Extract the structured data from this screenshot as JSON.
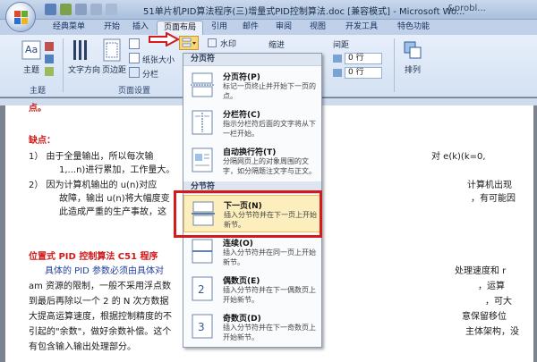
{
  "titlebar": {
    "doc_title": "51单片机PID算法程序(三)增量式PID控制算法.doc [兼容模式] - Microsoft Wo...",
    "right_text": "&probl..."
  },
  "tabs": [
    "经典菜单",
    "开始",
    "插入",
    "页面布局",
    "引用",
    "邮件",
    "审阅",
    "视图",
    "开发工具",
    "特色功能"
  ],
  "active_tab": "页面布局",
  "ribbon": {
    "group_theme": "主题",
    "group_page_setup": "页面设置",
    "theme_label": "主题",
    "text_direction": "文字方向",
    "margins": "页边距",
    "paper_size": "纸张大小",
    "columns": "分栏",
    "watermark": "水印",
    "indent": "缩进",
    "spacing": "间距",
    "spin1": "0 行",
    "spin2": "0 行",
    "arrange": "排列"
  },
  "menu": {
    "section1_header": "分页符",
    "section2_header": "分节符",
    "items": [
      {
        "title": "分页符(P)",
        "desc": "标记一页终止并开始下一页的点。"
      },
      {
        "title": "分栏符(C)",
        "desc": "指示分栏符后面的文字将从下一栏开始。"
      },
      {
        "title": "自动换行符(T)",
        "desc": "分隔网页上的对象周围的文字，如分隔题注文字与正文。"
      },
      {
        "title": "下一页(N)",
        "desc": "插入分节符并在下一页上开始新节。"
      },
      {
        "title": "连续(O)",
        "desc": "插入分节符并在同一页上开始新节。"
      },
      {
        "title": "偶数页(E)",
        "desc": "插入分节符并在下一偶数页上开始新节。"
      },
      {
        "title": "奇数页(D)",
        "desc": "插入分节符并在下一奇数页上开始新节。"
      }
    ]
  },
  "document": {
    "top_fragment": "点。",
    "heading1": "缺点：",
    "l1": "1）      由于全量输出，所以每次输",
    "l1r": "对 e(k)(k=0,",
    "l2": "1,...n)进行累加，工作量大。",
    "l3": "2）      因为计算机输出的 u(n)对应",
    "l3r": "计算机出现",
    "l4": "故障，输出 u(n)将大幅度变",
    "l4r": "，有可能因",
    "l5": "此造成严重的生产事故，这",
    "heading2": "位置式 PID 控制算法 C51 程序",
    "p1": "具体的 PID 参数必须由具体对",
    "p1r": "处理速度和 r",
    "p2": "am 资源的限制，一般不采用浮点数",
    "p2r": "，运算",
    "p3": "到最后再除以一个 2 的 N 次方数据",
    "p3r": "，可大",
    "p4": "大提高运算速度，根据控制精度的不",
    "p4r": "意保留移位",
    "p5": "引起的\"余数\"，做好余数补偿。这个",
    "p5r": "主体架构，没",
    "p6": "有包含输入输出处理部分。"
  },
  "colors": {
    "accent_red": "#d41a1a",
    "menu_highlight": "#fdeebd",
    "heading_red": "#d11a1a"
  }
}
